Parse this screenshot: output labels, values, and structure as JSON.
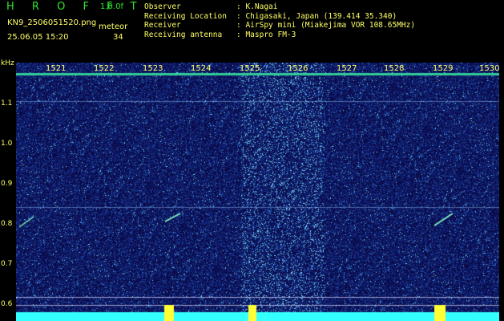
{
  "header": {
    "brand": "H R O F F T",
    "version": "1.0.0f",
    "filename": "KN9_2506051520.png",
    "datetime": "25.06.05 15:20",
    "mode": "meteor",
    "count": "34"
  },
  "info": [
    {
      "key": "Observer",
      "value": ": K.Nagai"
    },
    {
      "key": "Receiving Location",
      "value": ": Chigasaki, Japan (139.414 35.340)"
    },
    {
      "key": "Receiver",
      "value": ": AirSpy mini (Miakejima VOR 108.65MHz)"
    },
    {
      "key": "Receiving antenna",
      "value": ": Maspro FM-3"
    }
  ],
  "axes": {
    "y_unit": "kHz",
    "y_ticks": [
      "1.1",
      "1.0",
      "0.9",
      "0.8",
      "0.7",
      "0.6"
    ],
    "x_ticks": [
      "1521",
      "1522",
      "1523",
      "1524",
      "1525",
      "1526",
      "1527",
      "1528",
      "1529",
      "1530"
    ]
  },
  "colors": {
    "background": "#000000",
    "label": "#ffff66",
    "brand": "#2fe52f",
    "noise_base": "#0a0a4a",
    "carrier": "#33ffff"
  }
}
